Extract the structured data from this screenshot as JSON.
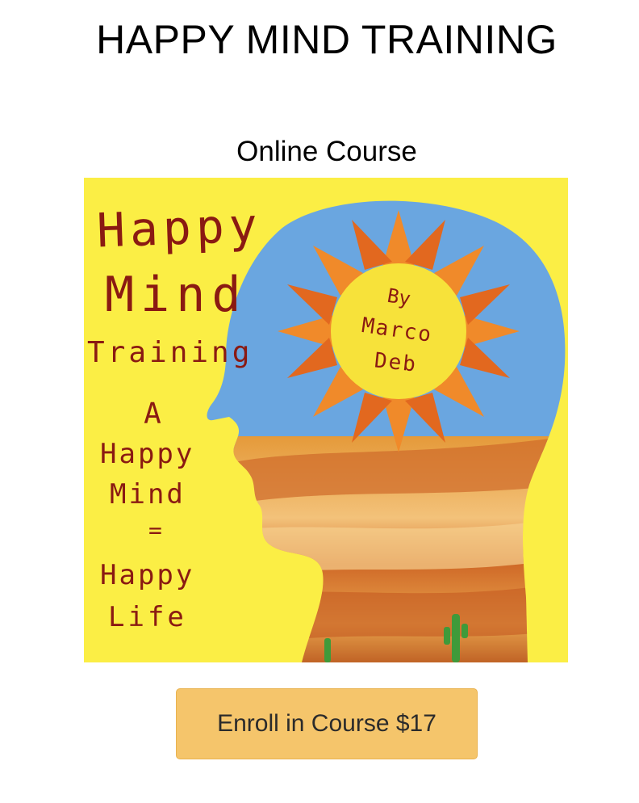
{
  "header": {
    "title": "HAPPY MIND TRAINING",
    "subtitle": "Online Course"
  },
  "cover": {
    "image_name": "happy-mind-cover-art",
    "title_line1": "Happy",
    "title_line2": "Mind",
    "title_line3": "Training",
    "tagline": [
      "A",
      "Happy",
      "Mind",
      "=",
      "Happy",
      "Life"
    ],
    "author_by": "By",
    "author_first": "Marco",
    "author_last": "Deb",
    "colors": {
      "background": "#fbee45",
      "text": "#8a1a12",
      "sky": "#6aa6e0",
      "sun": "#f7e23a",
      "rays": "#f08a2a",
      "desert": "#d7802f"
    }
  },
  "actions": {
    "enroll_label": "Enroll in Course $17"
  }
}
